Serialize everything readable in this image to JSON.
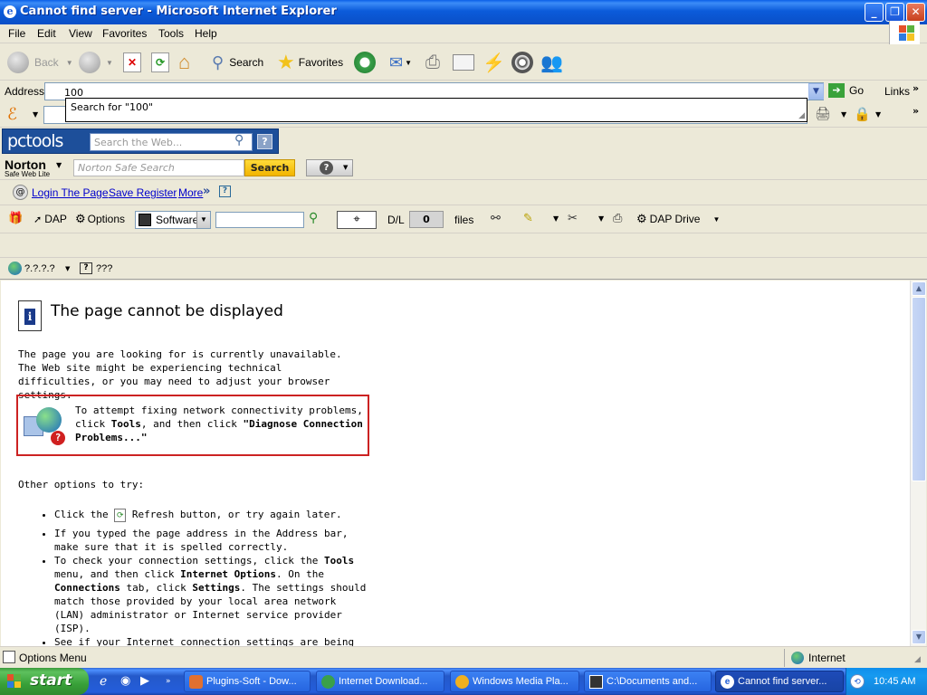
{
  "window": {
    "title": "Cannot find server - Microsoft Internet Explorer"
  },
  "menu": [
    "File",
    "Edit",
    "View",
    "Favorites",
    "Tools",
    "Help"
  ],
  "toolbar": {
    "back": "Back",
    "search": "Search",
    "favorites": "Favorites"
  },
  "address": {
    "label": "Address",
    "value": "100",
    "go": "Go",
    "links": "Links"
  },
  "suggest": {
    "text": "Search for \"100\""
  },
  "pctools": {
    "logo": "pctools",
    "placeholder": "Search the Web..."
  },
  "norton": {
    "logo": "Norton",
    "sub": "Safe Web Lite",
    "placeholder": "Norton Safe Search",
    "search_button": "Search"
  },
  "login": {
    "login_page": "Login The Page",
    "save_register": "Save Register",
    "more": "More"
  },
  "dap": {
    "dap": "DAP",
    "options": "Options",
    "software": "Software",
    "dl_label": "D/L",
    "dl_count": "0",
    "files": "files",
    "dap_drive": "DAP Drive"
  },
  "qrow": {
    "item1": "?.?.?.?",
    "item2": "???"
  },
  "content": {
    "heading": "The page cannot be displayed",
    "intro": "The page you are looking for is currently unavailable. The Web site might be experiencing technical difficulties, or you may need to adjust your browser settings.",
    "box_line1": "To attempt fixing network connectivity problems, click",
    "box_tools": "Tools",
    "box_mid": ", and then click ",
    "box_diag": "\"Diagnose Connection Problems...\"",
    "other": "Other options to try:",
    "b1_pre": "Click the",
    "b1_post": "Refresh button, or try again later.",
    "b2": "If you typed the page address in the Address bar, make sure that it is spelled correctly.",
    "b3_a": "To check your connection settings, click the ",
    "b3_tools": "Tools",
    "b3_b": " menu, and then click ",
    "b3_io": "Internet Options",
    "b3_c": ". On the ",
    "b3_conn": "Connections",
    "b3_d": " tab, click ",
    "b3_settings": "Settings",
    "b3_e": ". The settings should match those provided by your local area network (LAN) administrator or Internet service provider (ISP).",
    "b4": "See if your Internet connection settings are being detected. You can set Microsoft Windows to examine your network"
  },
  "status": {
    "left": "Options Menu",
    "zone": "Internet"
  },
  "taskbar": {
    "start": "start",
    "tasks": [
      "Plugins-Soft - Dow...",
      "Internet Download...",
      "Windows Media Pla...",
      "C:\\Documents and...",
      "Cannot find server..."
    ],
    "clock": "10:45 AM"
  }
}
